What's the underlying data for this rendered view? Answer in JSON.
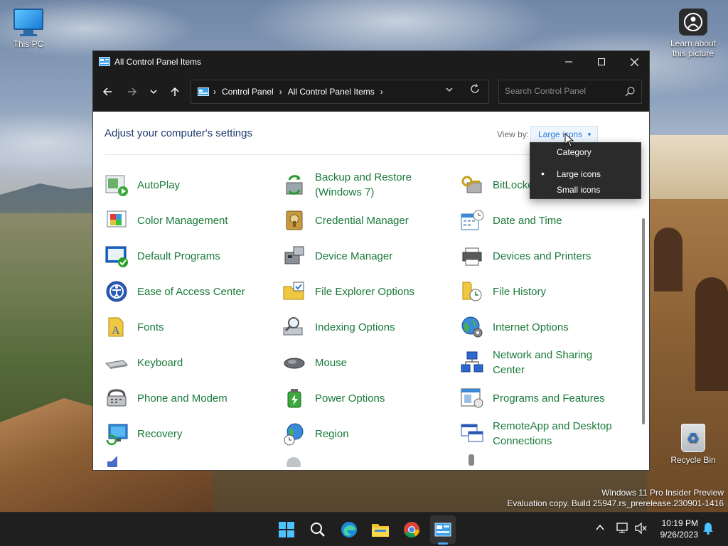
{
  "desktop": {
    "icons": [
      {
        "label": "This PC"
      },
      {
        "label": "Learn about this picture"
      },
      {
        "label": "Recycle Bin"
      }
    ],
    "watermark": {
      "line1": "Windows 11 Pro Insider Preview",
      "line2": "Evaluation copy. Build 25947.rs_prerelease.230901-1416"
    }
  },
  "window": {
    "title": "All Control Panel Items",
    "controls": {
      "minimize": "—",
      "maximize": "☐",
      "close": "✕"
    },
    "address": {
      "breadcrumbs": [
        "Control Panel",
        "All Control Panel Items"
      ]
    },
    "search": {
      "placeholder": "Search Control Panel"
    },
    "heading": "Adjust your computer's settings",
    "view_by": {
      "label": "View by:",
      "selected": "Large icons",
      "options": [
        "Category",
        "Large icons",
        "Small icons"
      ],
      "checked_index": 1
    },
    "items": [
      {
        "label": "AutoPlay",
        "icon": "autoplay-icon"
      },
      {
        "label": "Backup and Restore (Windows 7)",
        "icon": "backup-restore-icon"
      },
      {
        "label": "BitLocker Drive Encryption",
        "icon": "bitlocker-icon"
      },
      {
        "label": "Color Management",
        "icon": "color-management-icon"
      },
      {
        "label": "Credential Manager",
        "icon": "credential-manager-icon"
      },
      {
        "label": "Date and Time",
        "icon": "date-time-icon"
      },
      {
        "label": "Default Programs",
        "icon": "default-programs-icon"
      },
      {
        "label": "Device Manager",
        "icon": "device-manager-icon"
      },
      {
        "label": "Devices and Printers",
        "icon": "devices-printers-icon"
      },
      {
        "label": "Ease of Access Center",
        "icon": "ease-of-access-icon"
      },
      {
        "label": "File Explorer Options",
        "icon": "file-explorer-options-icon"
      },
      {
        "label": "File History",
        "icon": "file-history-icon"
      },
      {
        "label": "Fonts",
        "icon": "fonts-icon"
      },
      {
        "label": "Indexing Options",
        "icon": "indexing-options-icon"
      },
      {
        "label": "Internet Options",
        "icon": "internet-options-icon"
      },
      {
        "label": "Keyboard",
        "icon": "keyboard-icon"
      },
      {
        "label": "Mouse",
        "icon": "mouse-icon"
      },
      {
        "label": "Network and Sharing Center",
        "icon": "network-sharing-icon"
      },
      {
        "label": "Phone and Modem",
        "icon": "phone-modem-icon"
      },
      {
        "label": "Power Options",
        "icon": "power-options-icon"
      },
      {
        "label": "Programs and Features",
        "icon": "programs-features-icon"
      },
      {
        "label": "Recovery",
        "icon": "recovery-icon"
      },
      {
        "label": "Region",
        "icon": "region-icon"
      },
      {
        "label": "RemoteApp and Desktop Connections",
        "icon": "remoteapp-icon"
      }
    ]
  },
  "taskbar": {
    "apps": [
      "start-icon",
      "search-icon",
      "edge-icon",
      "file-explorer-icon",
      "chrome-icon",
      "control-panel-icon"
    ],
    "clock": {
      "time": "10:19 PM",
      "date": "9/26/2023"
    }
  },
  "colors": {
    "link_green": "#1a7a3a",
    "heading_blue": "#1e3a6e",
    "accent_blue": "#2a7ad8",
    "titlebar": "#1c1c1c"
  }
}
